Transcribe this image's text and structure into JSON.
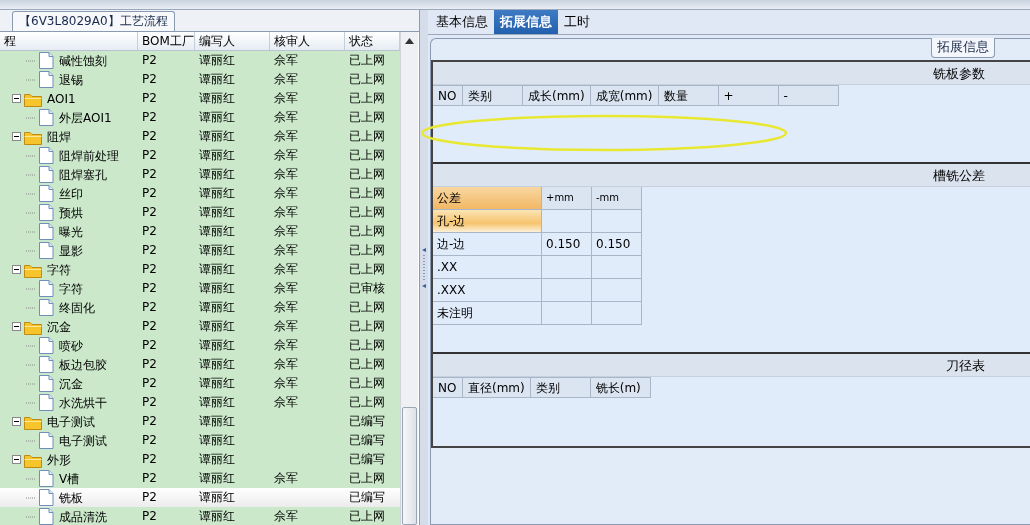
{
  "left": {
    "title": "【6V3L8029A0】工艺流程",
    "columns": [
      "程",
      "BOM工厂",
      "编写人",
      "核审人",
      "状态"
    ],
    "tree": [
      {
        "kind": "leaf",
        "name": "碱性蚀刻",
        "bom": "P2",
        "writer": "谭丽红",
        "reviewer": "佘军",
        "status": "已上网",
        "selected": false
      },
      {
        "kind": "leaf",
        "name": "退锡",
        "bom": "P2",
        "writer": "谭丽红",
        "reviewer": "佘军",
        "status": "已上网",
        "selected": false
      },
      {
        "kind": "folder",
        "name": "AOI1",
        "bom": "P2",
        "writer": "谭丽红",
        "reviewer": "佘军",
        "status": "已上网",
        "selected": false,
        "expanded": true,
        "children": [
          {
            "kind": "leaf",
            "name": "外层AOI1",
            "bom": "P2",
            "writer": "谭丽红",
            "reviewer": "佘军",
            "status": "已上网",
            "selected": false
          }
        ]
      },
      {
        "kind": "folder",
        "name": "阻焊",
        "bom": "P2",
        "writer": "谭丽红",
        "reviewer": "佘军",
        "status": "已上网",
        "selected": false,
        "expanded": true,
        "children": [
          {
            "kind": "leaf",
            "name": "阻焊前处理",
            "bom": "P2",
            "writer": "谭丽红",
            "reviewer": "佘军",
            "status": "已上网",
            "selected": false
          },
          {
            "kind": "leaf",
            "name": "阻焊塞孔",
            "bom": "P2",
            "writer": "谭丽红",
            "reviewer": "佘军",
            "status": "已上网",
            "selected": false
          },
          {
            "kind": "leaf",
            "name": "丝印",
            "bom": "P2",
            "writer": "谭丽红",
            "reviewer": "佘军",
            "status": "已上网",
            "selected": false
          },
          {
            "kind": "leaf",
            "name": "预烘",
            "bom": "P2",
            "writer": "谭丽红",
            "reviewer": "佘军",
            "status": "已上网",
            "selected": false
          },
          {
            "kind": "leaf",
            "name": "曝光",
            "bom": "P2",
            "writer": "谭丽红",
            "reviewer": "佘军",
            "status": "已上网",
            "selected": false
          },
          {
            "kind": "leaf",
            "name": "显影",
            "bom": "P2",
            "writer": "谭丽红",
            "reviewer": "佘军",
            "status": "已上网",
            "selected": false
          }
        ]
      },
      {
        "kind": "folder",
        "name": "字符",
        "bom": "P2",
        "writer": "谭丽红",
        "reviewer": "佘军",
        "status": "已上网",
        "selected": false,
        "expanded": true,
        "children": [
          {
            "kind": "leaf",
            "name": "字符",
            "bom": "P2",
            "writer": "谭丽红",
            "reviewer": "佘军",
            "status": "已审核",
            "selected": false
          },
          {
            "kind": "leaf",
            "name": "终固化",
            "bom": "P2",
            "writer": "谭丽红",
            "reviewer": "佘军",
            "status": "已上网",
            "selected": false
          }
        ]
      },
      {
        "kind": "folder",
        "name": "沉金",
        "bom": "P2",
        "writer": "谭丽红",
        "reviewer": "佘军",
        "status": "已上网",
        "selected": false,
        "expanded": true,
        "children": [
          {
            "kind": "leaf",
            "name": "喷砂",
            "bom": "P2",
            "writer": "谭丽红",
            "reviewer": "佘军",
            "status": "已上网",
            "selected": false
          },
          {
            "kind": "leaf",
            "name": "板边包胶",
            "bom": "P2",
            "writer": "谭丽红",
            "reviewer": "佘军",
            "status": "已上网",
            "selected": false
          },
          {
            "kind": "leaf",
            "name": "沉金",
            "bom": "P2",
            "writer": "谭丽红",
            "reviewer": "佘军",
            "status": "已上网",
            "selected": false
          },
          {
            "kind": "leaf",
            "name": "水洗烘干",
            "bom": "P2",
            "writer": "谭丽红",
            "reviewer": "佘军",
            "status": "已上网",
            "selected": false
          }
        ]
      },
      {
        "kind": "folder",
        "name": "电子测试",
        "bom": "P2",
        "writer": "谭丽红",
        "status": "已编写",
        "selected": false,
        "expanded": true,
        "children": [
          {
            "kind": "leaf",
            "name": "电子测试",
            "bom": "P2",
            "writer": "谭丽红",
            "status": "已编写",
            "selected": false
          }
        ]
      },
      {
        "kind": "folder",
        "name": "外形",
        "bom": "P2",
        "writer": "谭丽红",
        "status": "已编写",
        "selected": false,
        "expanded": true,
        "children": [
          {
            "kind": "leaf",
            "name": "V槽",
            "bom": "P2",
            "writer": "谭丽红",
            "reviewer": "佘军",
            "status": "已上网",
            "selected": false
          },
          {
            "kind": "leaf",
            "name": "铣板",
            "bom": "P2",
            "writer": "谭丽红",
            "status": "已编写",
            "selected": true
          },
          {
            "kind": "leaf",
            "name": "成品清洗",
            "bom": "P2",
            "writer": "谭丽红",
            "reviewer": "佘军",
            "status": "已上网",
            "selected": false
          }
        ]
      }
    ]
  },
  "right": {
    "tabs": [
      {
        "label": "基本信息",
        "selected": false
      },
      {
        "label": "拓展信息",
        "selected": true
      },
      {
        "label": "工时",
        "selected": false
      }
    ],
    "group_label": "拓展信息",
    "sections": [
      {
        "kind": "grid",
        "title": "铣板参数",
        "columns": [
          "NO",
          "类别",
          "成长(mm)",
          "成宽(mm)",
          "数量",
          "+",
          "-"
        ]
      },
      {
        "kind": "tolerance",
        "title": "槽铣公差",
        "columns": [
          "公差",
          "+mm",
          "-mm"
        ],
        "rows": [
          {
            "label": "孔-边",
            "selected": true
          },
          {
            "label": "边-边",
            "plus": "0.150",
            "minus": "0.150",
            "selected": false
          },
          {
            "label": ".XX",
            "selected": false
          },
          {
            "label": ".XXX",
            "selected": false
          },
          {
            "label": "未注明",
            "selected": false
          }
        ]
      },
      {
        "kind": "grid",
        "title": "刀径表",
        "columns": [
          "NO",
          "直径(mm)",
          "类别",
          "铣长(m)"
        ]
      }
    ]
  }
}
